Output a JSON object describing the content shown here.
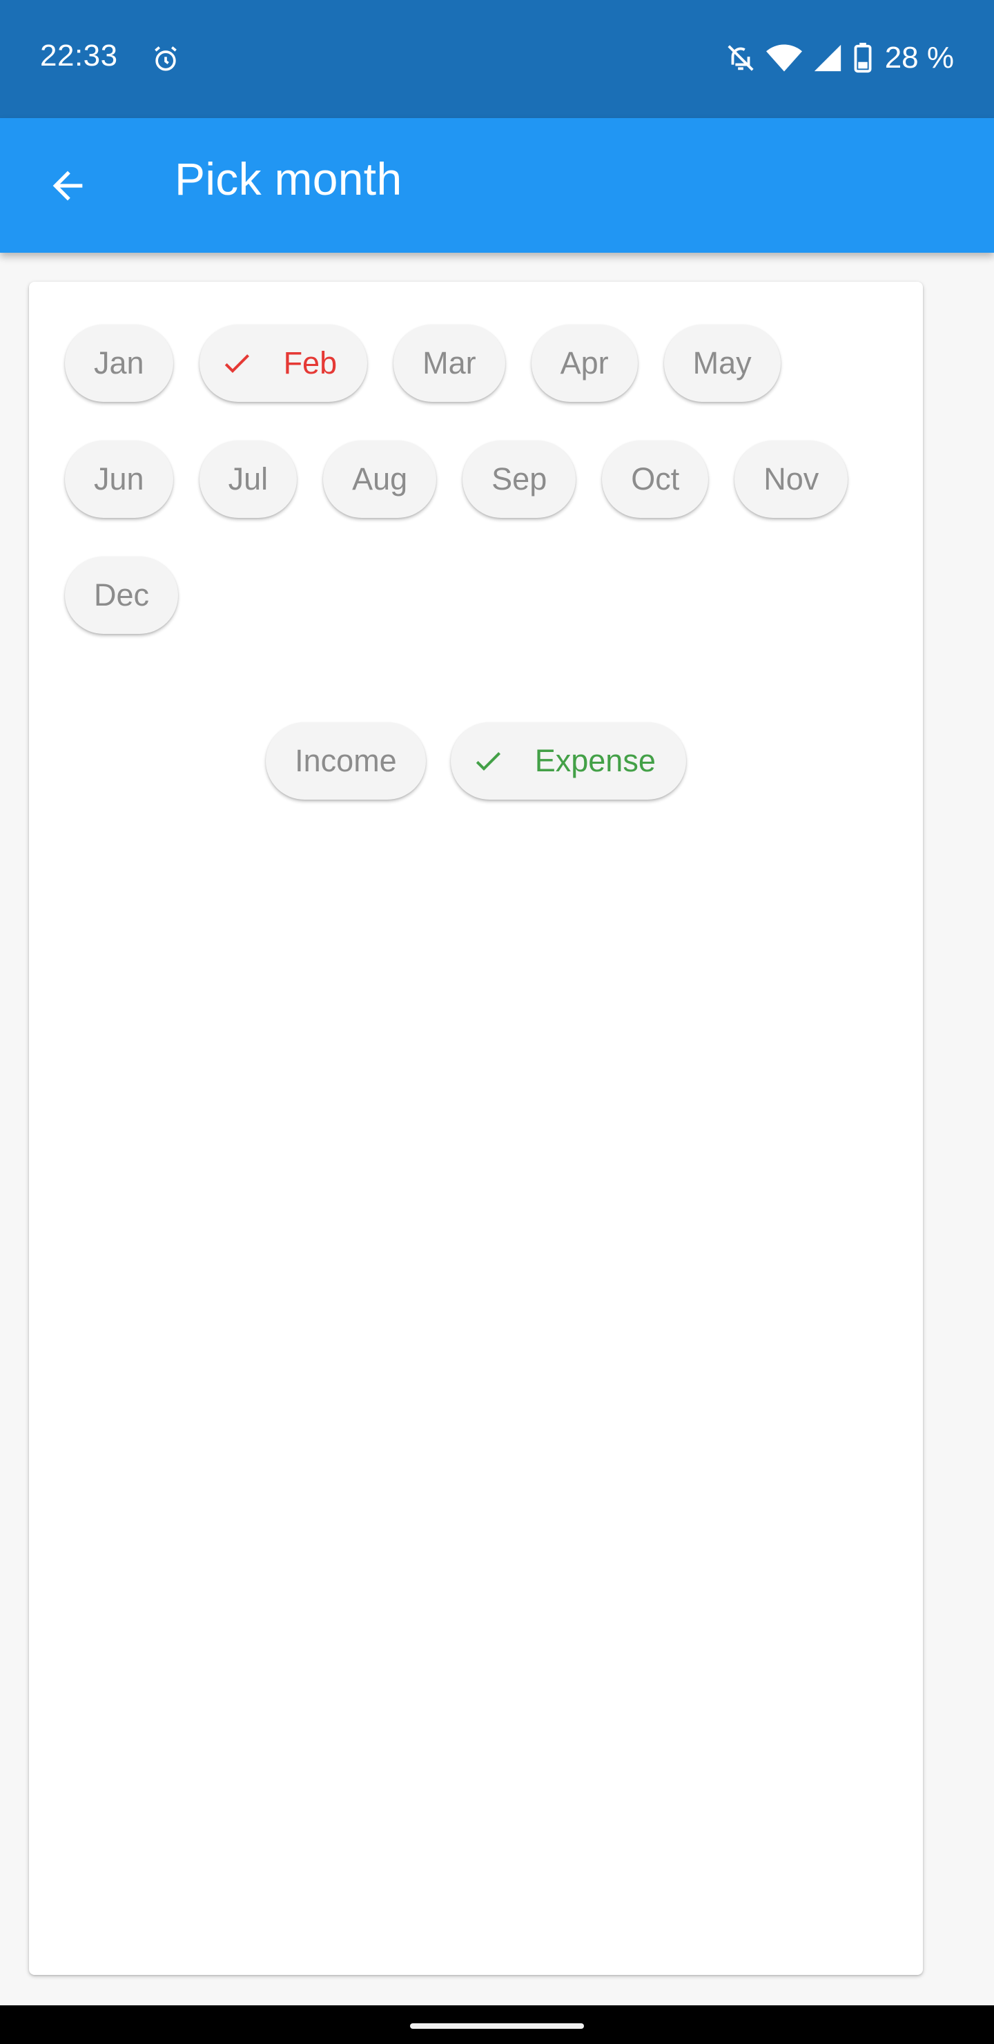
{
  "status_bar": {
    "time": "22:33",
    "battery": "28 %",
    "icons": [
      "alarm-icon",
      "notifications-off-icon",
      "wifi-icon",
      "cell-signal-icon",
      "battery-icon"
    ]
  },
  "app_bar": {
    "title": "Pick month",
    "back_icon": "arrow-back-icon"
  },
  "months": [
    {
      "label": "Jan",
      "selected": false
    },
    {
      "label": "Feb",
      "selected": true
    },
    {
      "label": "Mar",
      "selected": false
    },
    {
      "label": "Apr",
      "selected": false
    },
    {
      "label": "May",
      "selected": false
    },
    {
      "label": "Jun",
      "selected": false
    },
    {
      "label": "Jul",
      "selected": false
    },
    {
      "label": "Aug",
      "selected": false
    },
    {
      "label": "Sep",
      "selected": false
    },
    {
      "label": "Oct",
      "selected": false
    },
    {
      "label": "Nov",
      "selected": false
    },
    {
      "label": "Dec",
      "selected": false
    }
  ],
  "types": [
    {
      "label": "Income",
      "selected": false
    },
    {
      "label": "Expense",
      "selected": true
    }
  ],
  "colors": {
    "status_bar": "#1b6fb6",
    "app_bar": "#2196f3",
    "month_selected": "#e53935",
    "type_selected": "#43a047",
    "chip_text": "#8c8c8c",
    "chip_background": "#f4f4f4"
  }
}
